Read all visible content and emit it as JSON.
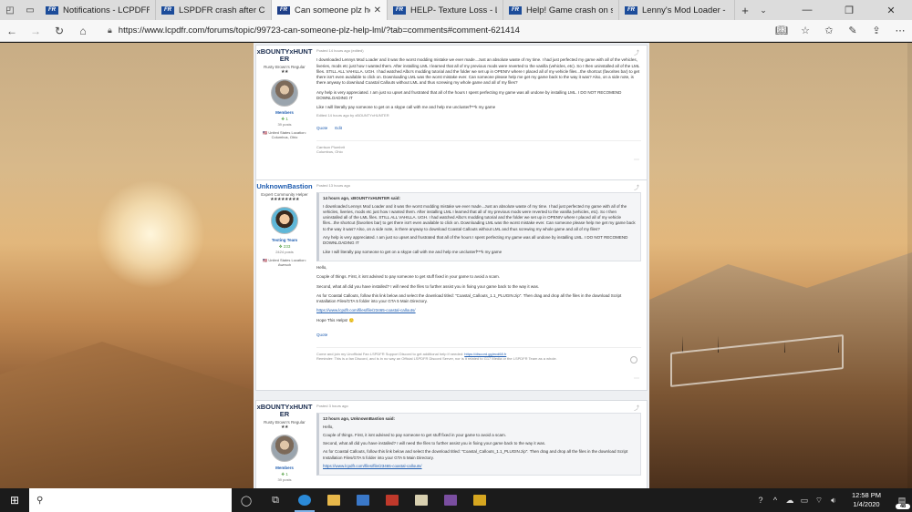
{
  "browser": {
    "tabs": [
      {
        "title": "Notifications - LCPDFR.com",
        "active": false
      },
      {
        "title": "LSPDFR crash after Coastal-",
        "active": false
      },
      {
        "title": "Can someone plz help?",
        "active": true
      },
      {
        "title": "HELP- Texture Loss - LSPDFI",
        "active": false
      },
      {
        "title": "Help! Game crash on startuj",
        "active": false
      },
      {
        "title": "Lenny's Mod Loader - Page",
        "active": false
      }
    ],
    "favicon_text": "FR",
    "url_scheme": "https://",
    "url_domain": "www.lcpdfr.com",
    "url_path": "/forums/topic/99723-can-someone-plz-help-lml/?tab=comments#comment-621414"
  },
  "posts": [
    {
      "username": "xBOUNTYxHUNTER",
      "rank": "Rusty Brown's Regular",
      "stars": "★★",
      "group": "Members",
      "reputation": "❖ 1",
      "post_count": "39 posts",
      "location": "🇺🇸 United States Location: Columbus, Ohio",
      "posted": "Posted 14 hours ago (edited)",
      "paragraphs": [
        "I downloaded Lennys Mod Loader and it was the worst modding mistake we ever made...Just an absolute waste of my time. I had just perfected my game with all of the vehicles, liveries, mods etc just how I wanted them. After installing LML I learned that all of my previous mods were reverted to the vanilla (vehicles, etc). So I then uninstalled all of the LML files. STILL ALL VAHILLA. UGH. I had watched Albo's modding tutorial and the folder we set up in OPENIV where I placed all of my vehicle files...the shortcut (favorites bar) to get there isn't even available to click on. Downloading LML was the worst mistake ever. Can someone please help me get my game back to the way it was? Also, on a side note, is there anyway to download Coastal Callouts without LML and thus screwing my whole game and all of my files?",
        "Any help is very appreciated. I am just so upset and frustrated that all of the hours I spent perfecting my game was all undone by installing LML. I DO NOT RECOMEND DOWNLOADING IT",
        "Like I will literally pay someone to get on a skype call with me and help me unclusterf***k my game"
      ],
      "edited": "Edited 14 hours ago by xBOUNTYxHUNTER",
      "actions": [
        "Quote",
        "Edit"
      ],
      "signature": "Carrison Plumbrit\nColumbus, Ohio"
    },
    {
      "username": "UnknownBastion",
      "rank": "Expert Community Helper",
      "stars": "★★★★★★★★",
      "group": "Testing Team",
      "reputation": "❖ 233",
      "post_count": "2424 posts",
      "location": "🇺🇸 United States Location: Awesoh",
      "posted": "Posted 13 hours ago",
      "quote_header": "14 hours ago, xBOUNTYxHUNTER said:",
      "quote_paragraphs": [
        "I downloaded Lennys Mod Loader and it was the worst modding mistake we ever made...Just an absolute waste of my time. I had just perfected my game with all of the vehicles, liveries, mods etc just how I wanted them. After installing LML I learned that all of my previous mods were reverted to the vanilla (vehicles, etc). So I then uninstalled all of the LML files. STILL ALL VAHILLA. UGH. I had watched Albo's modding tutorial and the folder we set up in OPENIV where I placed all of my vehicle files...the shortcut (favorites bar) to get there isn't even available to click on. Downloading LML was the worst mistake ever. Can someone please help me get my game back to the way it was? Also, on a side note, is there anyway to download Coastal Callouts without LML and thus screwing my whole game and all of my files?",
        "Any help is very appreciated. I am just so upset and frustrated that all of the hours I spent perfecting my game was all undone by installing LML. I DO NOT RECOMEND DOWNLOADING IT",
        "Like I will literally pay someone to get on a skype call with me and help me unclusterf***k my game"
      ],
      "paragraphs": [
        "Hello,",
        "Couple of things. First, it isnt advised to pay someone to get stuff fixed in your game to avoid a scam.",
        "Second, what all did you have installed? I will need the files to further assist you in fixing your game back to the way it was.",
        "As for Coastal Callouts, follow this link below and select the download titled: \"Coastal_Callouts_1.1_PLUGIN.zip\". Then drag and drop all the files in the download Script Installation Files/GTA 5 folder into your GTA 5 Main Directory."
      ],
      "link": "https://www.lcpdfr.com/files/file/23465-coastal-callouts/",
      "closing": "Hope This Helps! 🙂",
      "actions": [
        "Quote"
      ],
      "signature_line1": "Come and join my Unofficial Fan LSPDFR Support Discord to get additional help if needed:",
      "signature_link": "https://discord.gg/ecd68.fr",
      "signature_line2": "Reminder: This is a fan Discord, and is in no way an Official LSPDFR Discord Server, nor is it related to G17 Media or the LSPDFR Team as a whole."
    },
    {
      "username": "xBOUNTYxHUNTER",
      "rank": "Rusty Brown's Regular",
      "stars": "★★",
      "group": "Members",
      "reputation": "❖ 1",
      "post_count": "39 posts",
      "posted": "Posted 3 hours ago",
      "quote_header": "13 hours ago, UnknownBastion said:",
      "quote_paragraphs": [
        "Hello,",
        "Couple of things. First, it isnt advised to pay someone to get stuff fixed in your game to avoid a scam.",
        "Second, what all did you have installed? I will need the files to further assist you in fixing your game back to the way it was.",
        "As for Coastal Callouts, follow this link below and select the download titled: \"Coastal_Callouts_1.1_PLUGIN.zip\". Then drag and drop all the files in the download Script Installation Files/GTA 5 folder into your GTA 5 Main Directory."
      ],
      "quote_link": "https://www.lcpdfr.com/files/file/23465-coastal-callouts/"
    }
  ],
  "taskbar": {
    "time": "12:58 PM",
    "date": "1/4/2020",
    "notification_count": "48"
  }
}
